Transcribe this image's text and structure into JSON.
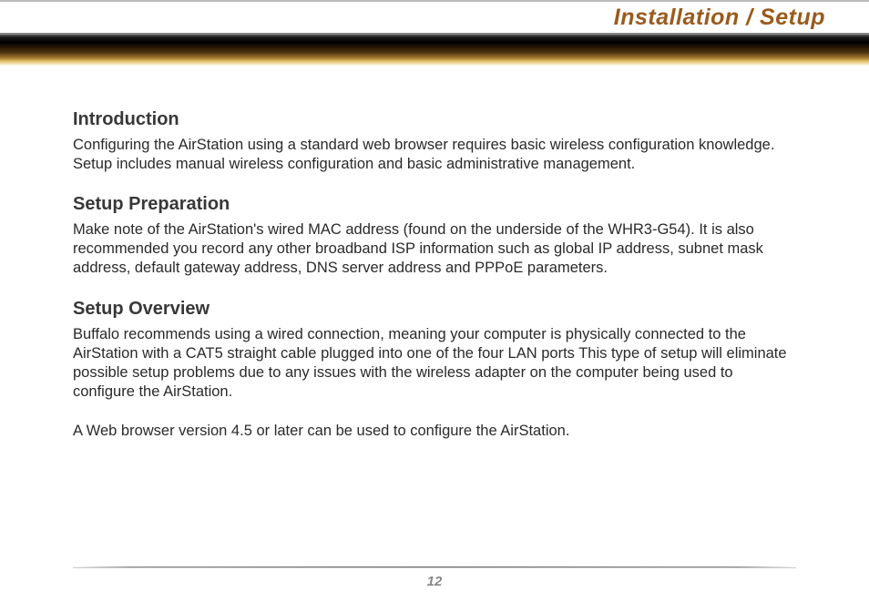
{
  "header": {
    "title": "Installation / Setup"
  },
  "sections": {
    "intro": {
      "heading": "Introduction",
      "body": "Configuring the AirStation using a standard web browser requires basic wireless configuration knowledge. Setup includes manual wireless configuration and basic administrative management."
    },
    "prep": {
      "heading": "Setup Preparation",
      "body": "Make note of the AirStation's wired MAC address (found on the underside of the WHR3-G54).  It is also recommended you record any other broadband ISP information such as global IP address, subnet mask address, default gateway address, DNS server address and PPPoE parameters."
    },
    "overview": {
      "heading": "Setup Overview",
      "body1": "Buffalo recommends using a wired connection, meaning your computer is physically connected to the AirStation with a CAT5 straight cable plugged into one of the four LAN ports  This type of setup will eliminate possible setup problems due to any issues with the wireless adapter on the computer being used to configure the AirStation.",
      "body2": "A Web browser version 4.5 or later can be used to configure the AirStation."
    }
  },
  "footer": {
    "page_number": "12"
  }
}
